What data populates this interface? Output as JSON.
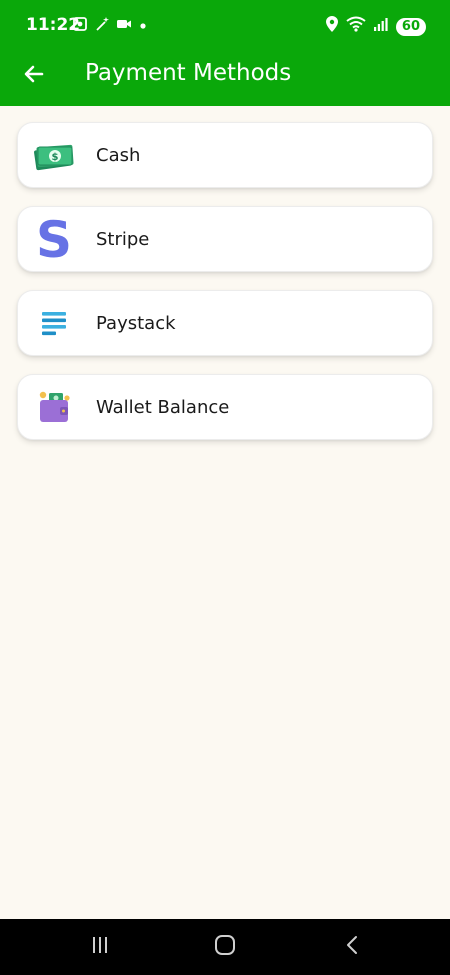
{
  "status_bar": {
    "time": "11:22",
    "battery": "60",
    "icons": [
      "screenshot-icon",
      "magic-wand-icon",
      "video-camera-icon",
      "dot-icon",
      "location-icon",
      "wifi-icon",
      "signal-icon"
    ]
  },
  "app_bar": {
    "title": "Payment Methods",
    "back_icon": "arrow-left-icon"
  },
  "payment_methods": [
    {
      "label": "Cash",
      "icon": "cash-icon"
    },
    {
      "label": "Stripe",
      "icon": "stripe-icon"
    },
    {
      "label": "Paystack",
      "icon": "paystack-icon"
    },
    {
      "label": "Wallet Balance",
      "icon": "wallet-icon"
    }
  ],
  "colors": {
    "primary": "#0aa80a",
    "background": "#fcf9f2",
    "stripe": "#6772e5",
    "paystack": "#3bb0e0",
    "wallet": "#9b6fd6",
    "cash": "#2fa36b"
  },
  "nav_bar": {
    "buttons": [
      "recent-apps-icon",
      "home-icon",
      "back-icon"
    ]
  }
}
